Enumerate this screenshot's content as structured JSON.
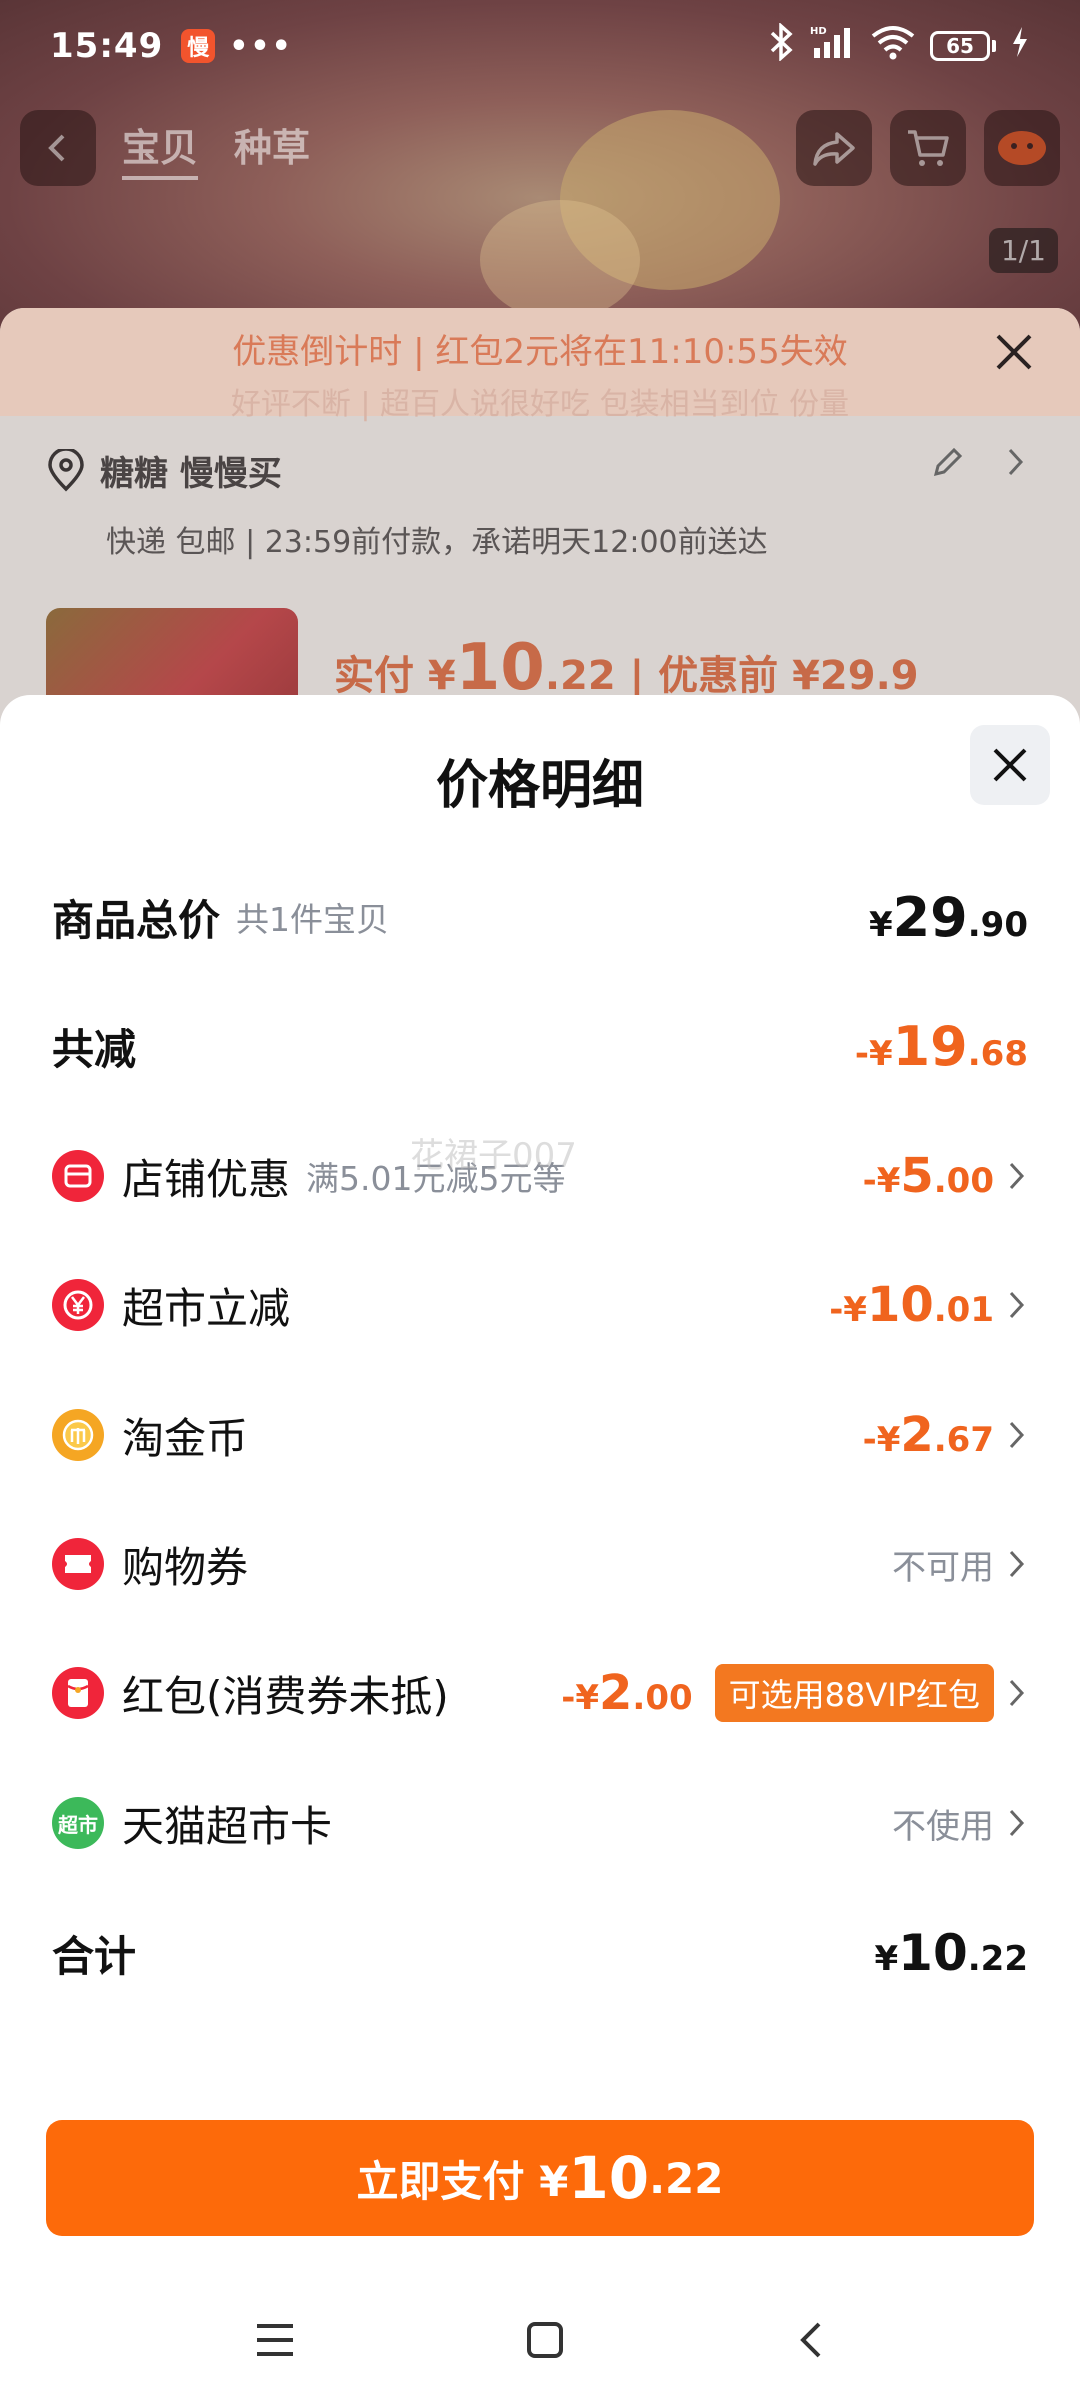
{
  "status_bar": {
    "time": "15:49",
    "app_badge": "慢",
    "dots": "•••",
    "battery": "65"
  },
  "background": {
    "nav_tabs": [
      "宝贝",
      "种草"
    ],
    "image_counter": "1/1",
    "countdown": "优惠倒计时 | 红包2元将在11:10:55失效",
    "banner_sub": "好评不断 | 超百人说很好吃 包装相当到位 份量",
    "address_name": "糖糖 慢慢买",
    "address_info": "快递 包邮 | 23:59前付款，承诺明天12:00前送达",
    "paid_label": "实付 ¥",
    "paid_big": "10",
    "paid_dec": ".22",
    "before_label": " | 优惠前 ¥29.9"
  },
  "sheet": {
    "title": "价格明细",
    "rows": {
      "total": {
        "label": "商品总价",
        "sub": "共1件宝贝",
        "prefix": "¥",
        "big": "29",
        "dec": ".90"
      },
      "reduce": {
        "label": "共减",
        "prefix": "-¥",
        "big": "19",
        "dec": ".68"
      },
      "shop": {
        "label": "店铺优惠",
        "sub": "满5.01元减5元等",
        "prefix": "-¥",
        "big": "5",
        "dec": ".00"
      },
      "market": {
        "label": "超市立减",
        "prefix": "-¥",
        "big": "10",
        "dec": ".01"
      },
      "coin": {
        "label": "淘金币",
        "prefix": "-¥",
        "big": "2",
        "dec": ".67"
      },
      "voucher": {
        "label": "购物券",
        "value": "不可用"
      },
      "redpacket": {
        "label": "红包(消费券未抵)",
        "prefix": "-¥",
        "big": "2",
        "dec": ".00",
        "badge": "可选用88VIP红包"
      },
      "card": {
        "label": "天猫超市卡",
        "value": "不使用",
        "icon_text": "超市"
      },
      "sum": {
        "label": "合计",
        "prefix": "¥",
        "big": "10",
        "dec": ".22"
      }
    },
    "watermark": "花裙子007",
    "pay_button": {
      "label": "立即支付 ¥",
      "big": "10",
      "dec": ".22"
    }
  },
  "colors": {
    "accent": "#fd6a0a",
    "discount": "#f0641e",
    "muted": "#8a8f99",
    "red_icon": "#f0253a",
    "gold_icon": "#f5a623",
    "green_icon": "#3cb95a"
  }
}
